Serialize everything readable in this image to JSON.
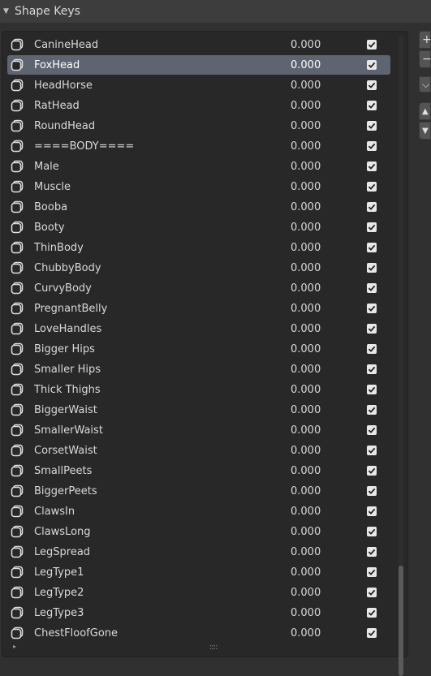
{
  "panel": {
    "title": "Shape Keys"
  },
  "side_buttons": {
    "add_symbol": "+",
    "remove_symbol": "−",
    "menu_symbol": "⌵",
    "up_symbol": "▲",
    "down_symbol": "▼"
  },
  "footer": {
    "grip": "::::",
    "expand_symbol": "▸"
  },
  "shape_keys": [
    {
      "name": "CanineHead",
      "value": "0.000",
      "checked": true
    },
    {
      "name": "FoxHead",
      "value": "0.000",
      "checked": true,
      "selected": true
    },
    {
      "name": "HeadHorse",
      "value": "0.000",
      "checked": true
    },
    {
      "name": "RatHead",
      "value": "0.000",
      "checked": true
    },
    {
      "name": "RoundHead",
      "value": "0.000",
      "checked": true
    },
    {
      "name": "====BODY====",
      "value": "0.000",
      "checked": true
    },
    {
      "name": "Male",
      "value": "0.000",
      "checked": true
    },
    {
      "name": "Muscle",
      "value": "0.000",
      "checked": true
    },
    {
      "name": "Booba",
      "value": "0.000",
      "checked": true
    },
    {
      "name": "Booty",
      "value": "0.000",
      "checked": true
    },
    {
      "name": "ThinBody",
      "value": "0.000",
      "checked": true
    },
    {
      "name": "ChubbyBody",
      "value": "0.000",
      "checked": true
    },
    {
      "name": "CurvyBody",
      "value": "0.000",
      "checked": true
    },
    {
      "name": "PregnantBelly",
      "value": "0.000",
      "checked": true
    },
    {
      "name": "LoveHandles",
      "value": "0.000",
      "checked": true
    },
    {
      "name": "Bigger Hips",
      "value": "0.000",
      "checked": true
    },
    {
      "name": "Smaller Hips",
      "value": "0.000",
      "checked": true
    },
    {
      "name": "Thick Thighs",
      "value": "0.000",
      "checked": true
    },
    {
      "name": "BiggerWaist",
      "value": "0.000",
      "checked": true
    },
    {
      "name": "SmallerWaist",
      "value": "0.000",
      "checked": true
    },
    {
      "name": "CorsetWaist",
      "value": "0.000",
      "checked": true
    },
    {
      "name": "SmallPeets",
      "value": "0.000",
      "checked": true
    },
    {
      "name": "BiggerPeets",
      "value": "0.000",
      "checked": true
    },
    {
      "name": "ClawsIn",
      "value": "0.000",
      "checked": true
    },
    {
      "name": "ClawsLong",
      "value": "0.000",
      "checked": true
    },
    {
      "name": "LegSpread",
      "value": "0.000",
      "checked": true
    },
    {
      "name": "LegType1",
      "value": "0.000",
      "checked": true
    },
    {
      "name": "LegType2",
      "value": "0.000",
      "checked": true
    },
    {
      "name": "LegType3",
      "value": "0.000",
      "checked": true
    },
    {
      "name": "ChestFloofGone",
      "value": "0.000",
      "checked": true
    }
  ]
}
